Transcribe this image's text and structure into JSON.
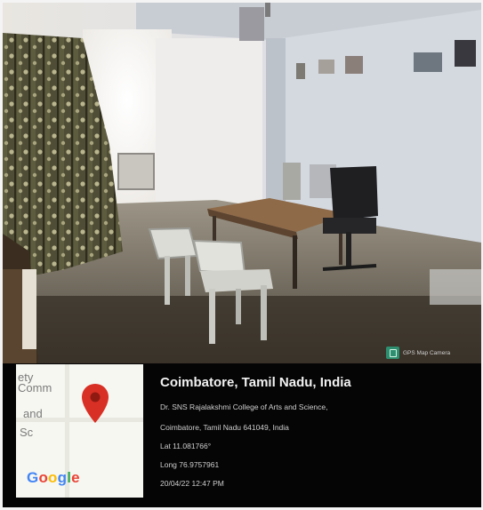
{
  "overlay": {
    "title": "Coimbatore, Tamil Nadu, India",
    "address_line1": "Dr. SNS Rajalakshmi College of Arts and Science,",
    "address_line2": "Coimbatore, Tamil Nadu 641049, India",
    "latitude": "Lat 11.081766°",
    "longitude": "Long 76.9757961",
    "timestamp": "20/04/22 12:47 PM"
  },
  "badge": {
    "text": "GPS Map Camera",
    "icon": "map-camera-icon"
  },
  "map_thumbnail": {
    "labels": [
      "ety",
      "Comm",
      "and",
      "Sc"
    ],
    "logo": "Google",
    "pin_icon": "location-pin-icon"
  },
  "colors": {
    "caption_background": "#050505",
    "pin": "#d93025",
    "google_blue": "#4285f4",
    "google_red": "#ea4335",
    "google_yellow": "#fbbc05",
    "google_green": "#34a853"
  }
}
